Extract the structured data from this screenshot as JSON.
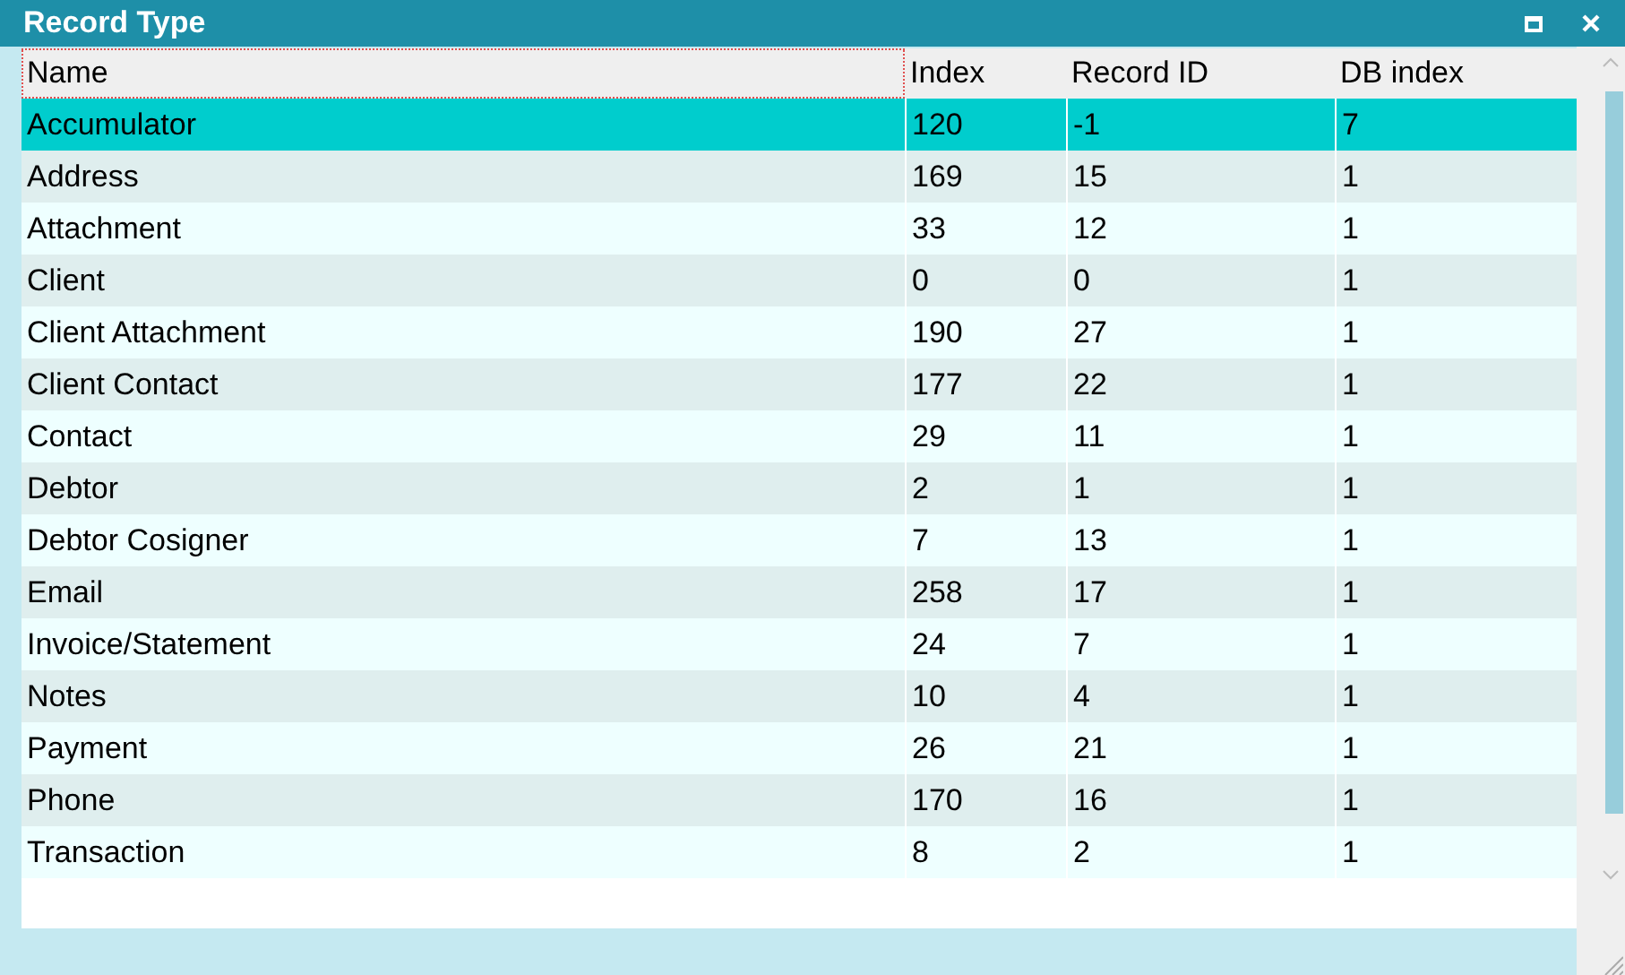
{
  "window": {
    "title": "Record Type"
  },
  "table": {
    "columns": [
      "Name",
      "Index",
      "Record ID",
      "DB index"
    ],
    "rows": [
      {
        "cells": [
          "Accumulator",
          "120",
          "-1",
          "7"
        ],
        "selected": true
      },
      {
        "cells": [
          "Address",
          "169",
          "15",
          "1"
        ],
        "selected": false
      },
      {
        "cells": [
          "Attachment",
          "33",
          "12",
          "1"
        ],
        "selected": false
      },
      {
        "cells": [
          "Client",
          "0",
          "0",
          "1"
        ],
        "selected": false
      },
      {
        "cells": [
          "Client Attachment",
          "190",
          "27",
          "1"
        ],
        "selected": false
      },
      {
        "cells": [
          "Client Contact",
          "177",
          "22",
          "1"
        ],
        "selected": false
      },
      {
        "cells": [
          "Contact",
          "29",
          "11",
          "1"
        ],
        "selected": false
      },
      {
        "cells": [
          "Debtor",
          "2",
          "1",
          "1"
        ],
        "selected": false
      },
      {
        "cells": [
          "Debtor Cosigner",
          "7",
          "13",
          "1"
        ],
        "selected": false
      },
      {
        "cells": [
          "Email",
          "258",
          "17",
          "1"
        ],
        "selected": false
      },
      {
        "cells": [
          "Invoice/Statement",
          "24",
          "7",
          "1"
        ],
        "selected": false
      },
      {
        "cells": [
          "Notes",
          "10",
          "4",
          "1"
        ],
        "selected": false
      },
      {
        "cells": [
          "Payment",
          "26",
          "21",
          "1"
        ],
        "selected": false
      },
      {
        "cells": [
          "Phone",
          "170",
          "16",
          "1"
        ],
        "selected": false
      },
      {
        "cells": [
          "Transaction",
          "8",
          "2",
          "1"
        ],
        "selected": false
      }
    ]
  }
}
